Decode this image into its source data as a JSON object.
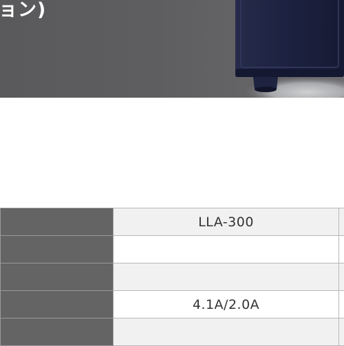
{
  "hero": {
    "title_fragment": "ョン)"
  },
  "spec_table": {
    "rows": [
      {
        "label": "",
        "value": "LLA-300"
      },
      {
        "label": "",
        "value": ""
      },
      {
        "label": "",
        "value": ""
      },
      {
        "label": "",
        "value": "4.1A/2.0A"
      },
      {
        "label": "",
        "value": ""
      }
    ]
  },
  "colors": {
    "banner": "#5e5e60",
    "label_cell": "#646464",
    "shaded_cell": "#f1f1f1",
    "product_body": "#1c2140"
  }
}
